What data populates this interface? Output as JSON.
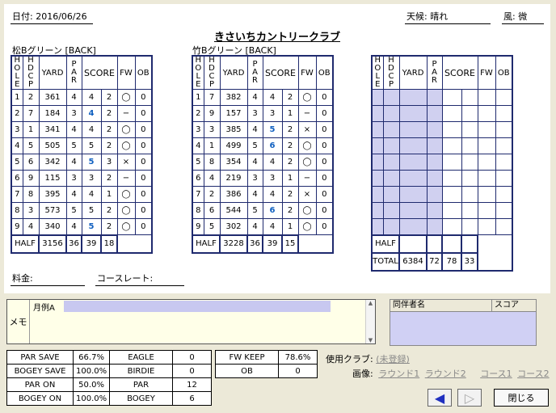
{
  "header": {
    "date": "日付: 2016/06/26",
    "weather": "天候: 晴れ",
    "wind": "風: 微"
  },
  "course_title": "きさいちカントリークラブ",
  "col_headers": {
    "hole": "HOLE",
    "hdcp": "HDCP",
    "yard": "YARD",
    "par": "PAR",
    "score": "SCORE",
    "fw": "FW",
    "ob": "OB"
  },
  "half_label": "HALF",
  "total_label": "TOTAL",
  "card1": {
    "title": "松Bグリーン [BACK]",
    "rows": [
      [
        "1",
        "2",
        "361",
        "4",
        "4",
        "2",
        "◯",
        "0"
      ],
      [
        "2",
        "7",
        "184",
        "3",
        "4",
        "2",
        "−",
        "0"
      ],
      [
        "3",
        "1",
        "341",
        "4",
        "4",
        "2",
        "◯",
        "0"
      ],
      [
        "4",
        "5",
        "505",
        "5",
        "5",
        "2",
        "◯",
        "0"
      ],
      [
        "5",
        "6",
        "342",
        "4",
        "5",
        "3",
        "×",
        "0"
      ],
      [
        "6",
        "9",
        "115",
        "3",
        "3",
        "2",
        "−",
        "0"
      ],
      [
        "7",
        "8",
        "395",
        "4",
        "4",
        "1",
        "◯",
        "0"
      ],
      [
        "8",
        "3",
        "573",
        "5",
        "5",
        "2",
        "◯",
        "0"
      ],
      [
        "9",
        "4",
        "340",
        "4",
        "5",
        "2",
        "◯",
        "0"
      ]
    ],
    "half": [
      "3156",
      "36",
      "39",
      "18"
    ]
  },
  "card2": {
    "title": "竹Bグリーン [BACK]",
    "rows": [
      [
        "1",
        "7",
        "382",
        "4",
        "4",
        "2",
        "◯",
        "0"
      ],
      [
        "2",
        "9",
        "157",
        "3",
        "3",
        "1",
        "−",
        "0"
      ],
      [
        "3",
        "3",
        "385",
        "4",
        "5",
        "2",
        "×",
        "0"
      ],
      [
        "4",
        "1",
        "499",
        "5",
        "6",
        "2",
        "◯",
        "0"
      ],
      [
        "5",
        "8",
        "354",
        "4",
        "4",
        "2",
        "◯",
        "0"
      ],
      [
        "6",
        "4",
        "219",
        "3",
        "3",
        "1",
        "−",
        "0"
      ],
      [
        "7",
        "2",
        "386",
        "4",
        "4",
        "2",
        "×",
        "0"
      ],
      [
        "8",
        "6",
        "544",
        "5",
        "6",
        "2",
        "◯",
        "0"
      ],
      [
        "9",
        "5",
        "302",
        "4",
        "4",
        "1",
        "◯",
        "0"
      ]
    ],
    "half": [
      "3228",
      "36",
      "39",
      "15"
    ]
  },
  "total": [
    "6384",
    "72",
    "78",
    "33"
  ],
  "fee_label": "料金:",
  "course_rate_label": "コースレート:",
  "memo": {
    "label": "メモ",
    "legend": "月例A"
  },
  "companion": {
    "name_header": "同伴者名",
    "score_header": "スコア"
  },
  "stats1": [
    [
      "PAR SAVE",
      "66.7%"
    ],
    [
      "BOGEY SAVE",
      "100.0%"
    ],
    [
      "PAR ON",
      "50.0%"
    ],
    [
      "BOGEY ON",
      "100.0%"
    ]
  ],
  "stats2": [
    [
      "EAGLE",
      "0"
    ],
    [
      "BIRDIE",
      "0"
    ],
    [
      "PAR",
      "12"
    ],
    [
      "BOGEY",
      "6"
    ]
  ],
  "stats3": [
    [
      "FW KEEP",
      "78.6%"
    ],
    [
      "OB",
      "0"
    ]
  ],
  "club": {
    "label": "使用クラブ:",
    "value": "(未登録)"
  },
  "images": {
    "label": "画像:",
    "items": [
      "ラウンド1",
      "ラウンド2",
      "コース1",
      "コース2"
    ]
  },
  "buttons": {
    "close": "閉じる"
  },
  "colors": {
    "accent": "#1f2a6e",
    "score_blue": "#1060c0",
    "lavender": "#d0d0f0"
  }
}
